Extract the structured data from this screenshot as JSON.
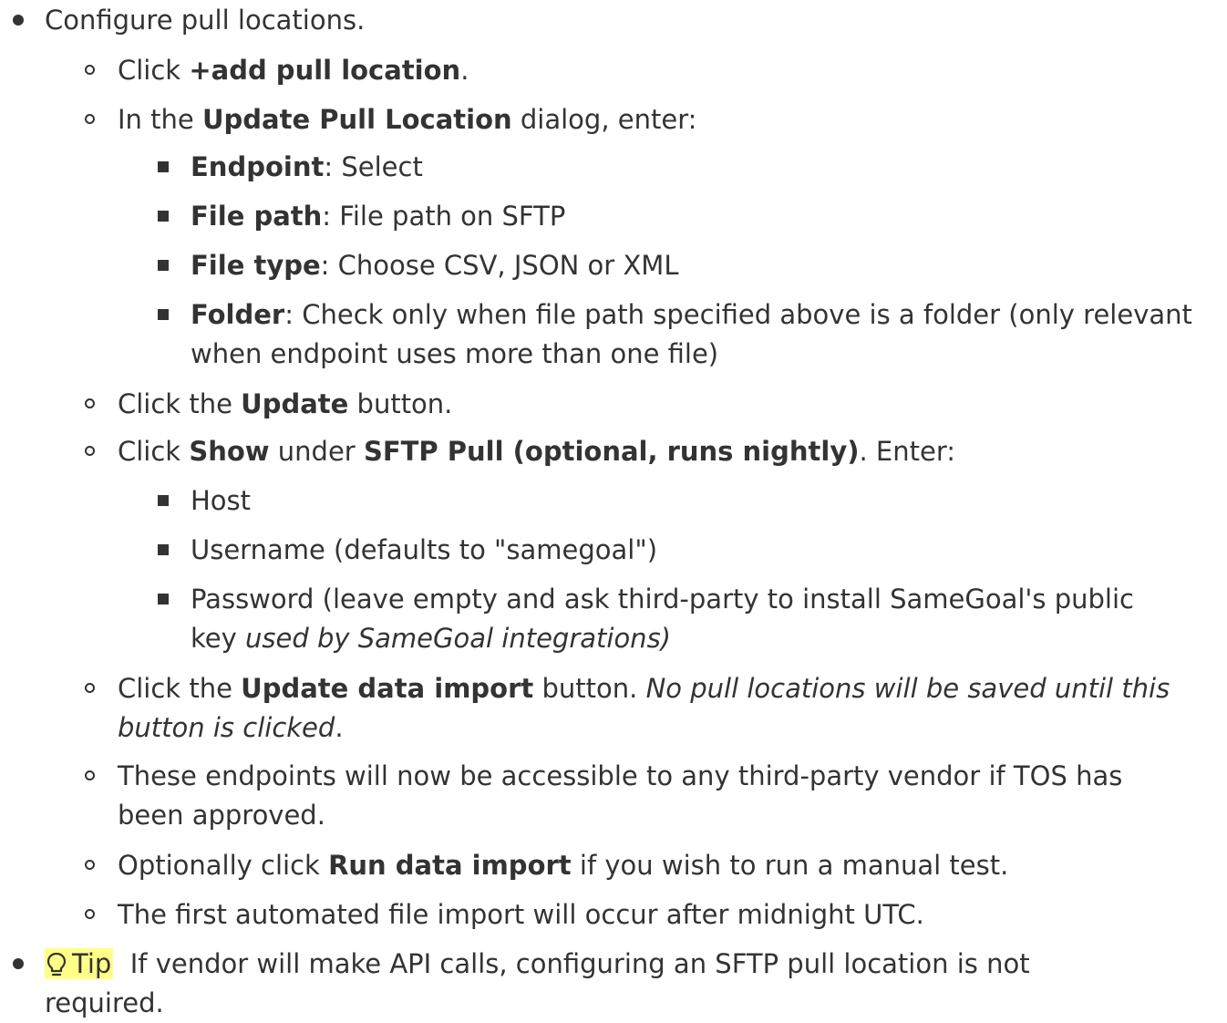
{
  "items": {
    "configure": {
      "text": "Configure pull locations."
    },
    "add": {
      "pre": "Click ",
      "bold": "+add pull location",
      "post": "."
    },
    "dialog": {
      "pre": "In the ",
      "bold": "Update Pull Location",
      "post": " dialog, enter:"
    },
    "endpoint": {
      "bold": "Endpoint",
      "post": ": Select"
    },
    "filepath": {
      "bold": "File path",
      "post": ": File path on SFTP"
    },
    "filetype": {
      "bold": "File type",
      "post": ": Choose CSV, JSON or XML"
    },
    "folder": {
      "bold": "Folder",
      "post": ": Check only when file path specified above is a folder (only relevant",
      "line2": "when endpoint uses more than one file)"
    },
    "update": {
      "pre": "Click the ",
      "bold": "Update",
      "post": " button."
    },
    "show": {
      "pre": "Click ",
      "bold1": "Show",
      "mid": " under ",
      "bold2": "SFTP Pull (optional, runs nightly)",
      "post": ". Enter:"
    },
    "host": {
      "text": "Host"
    },
    "username": {
      "text": "Username (defaults to \"samegoal\")"
    },
    "password": {
      "text": "Password (leave empty and ask third-party to install SameGoal's public",
      "line2_pre": "key ",
      "line2_italic": "used by SameGoal integrations)"
    },
    "update_import": {
      "pre": "Click the ",
      "bold": "Update data import",
      "post": " button. ",
      "italic": "No pull locations will be saved until this",
      "line2_italic": "button is clicked",
      "line2_post": "."
    },
    "accessible": {
      "text": "These endpoints will now be accessible to any third-party vendor if TOS has",
      "line2": "been approved."
    },
    "run": {
      "pre": "Optionally click ",
      "bold": "Run data import",
      "post": " if you wish to run a manual test."
    },
    "first": {
      "text": "The first automated file import will occur after midnight UTC."
    },
    "tip": {
      "icon": "lightbulb-icon",
      "label": "Tip",
      "text": "If vendor will make API calls, configuring an SFTP pull location is not",
      "line2": "required."
    }
  },
  "colors": {
    "text": "#333333",
    "tip_highlight": "#ffff88"
  }
}
